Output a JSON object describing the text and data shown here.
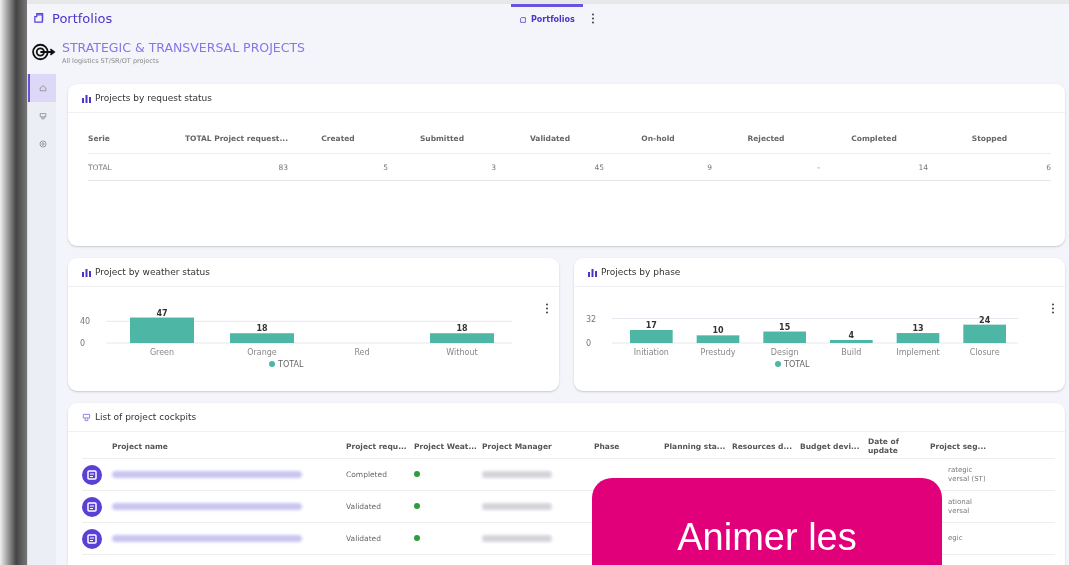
{
  "header": {
    "title": "Portfolios",
    "tabs": [
      {
        "label": "Portfolios",
        "selected": true
      }
    ]
  },
  "portfolio": {
    "title": "STRATEGIC & TRANSVERSAL PROJECTS",
    "subtitle": "All logistics ST/SR/OT projects"
  },
  "sidebar": {
    "items": [
      {
        "kind": "home",
        "selected": true
      },
      {
        "kind": "cockpit",
        "selected": false
      },
      {
        "kind": "help",
        "selected": false
      }
    ]
  },
  "request_status": {
    "title": "Projects by request status",
    "columns": [
      "Serie",
      "TOTAL Project request...",
      "Created",
      "Submitted",
      "Validated",
      "On-hold",
      "Rejected",
      "Completed",
      "Stopped"
    ],
    "rows": [
      [
        "TOTAL",
        "83",
        "5",
        "3",
        "45",
        "9",
        "-",
        "14",
        "6"
      ]
    ]
  },
  "weather_chart": {
    "title": "Project by weather status",
    "chart_data": {
      "type": "bar",
      "categories": [
        "Green",
        "Orange",
        "Red",
        "Without"
      ],
      "series": [
        {
          "name": "TOTAL",
          "color": "#4db6a4",
          "values": [
            47,
            18,
            null,
            18
          ]
        }
      ],
      "ylim": [
        0,
        48
      ],
      "yticks": [
        0,
        40
      ],
      "data_labels": true
    }
  },
  "phase_chart": {
    "title": "Projects by phase",
    "chart_data": {
      "type": "bar",
      "categories": [
        "Initiation",
        "Prestudy",
        "Design",
        "Build",
        "Implement",
        "Closure"
      ],
      "series": [
        {
          "name": "TOTAL",
          "color": "#4db6a4",
          "values": [
            17,
            10,
            15,
            4,
            13,
            24
          ]
        }
      ],
      "ylim": [
        0,
        34
      ],
      "yticks": [
        0,
        32
      ],
      "data_labels": true
    }
  },
  "cockpits": {
    "title": "List of project cockpits",
    "columns": [
      "Project name",
      "Project requ...",
      "Project Weat...",
      "Project Manager",
      "Phase",
      "Planning sta...",
      "Resources d...",
      "Budget devi...",
      "Date of update",
      "Project seg..."
    ],
    "rows": [
      {
        "status": "Completed",
        "segment": [
          "rategic",
          "versal (ST)"
        ]
      },
      {
        "status": "Validated",
        "segment": [
          "ational",
          "versal"
        ]
      },
      {
        "status": "Validated",
        "segment": [
          "egic"
        ]
      }
    ]
  },
  "overlay": {
    "text": "Animer les"
  }
}
